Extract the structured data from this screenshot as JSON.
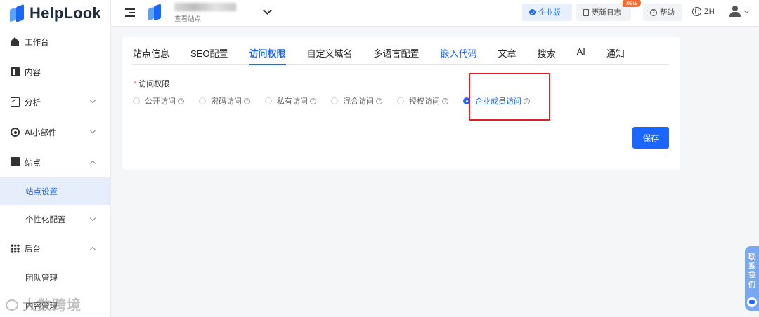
{
  "brand": {
    "name": "HelpLook"
  },
  "sidebar": {
    "items": [
      {
        "label": "工作台",
        "icon": "home-icon"
      },
      {
        "label": "内容",
        "icon": "book-icon"
      },
      {
        "label": "分析",
        "icon": "chart-icon",
        "expandable": true
      },
      {
        "label": "AI小部件",
        "icon": "ai-widget-icon",
        "expandable": true
      },
      {
        "label": "站点",
        "icon": "monitor-icon",
        "expanded": true
      }
    ],
    "site_sub": [
      {
        "label": "站点设置",
        "active": true
      },
      {
        "label": "个性化配置",
        "expandable": true
      }
    ],
    "backend": {
      "label": "后台",
      "icon": "grid-icon",
      "expanded": true
    },
    "backend_sub": [
      {
        "label": "团队管理"
      },
      {
        "label": "内容管理"
      }
    ]
  },
  "header": {
    "view_site": "查看站点",
    "enterprise": "企业版",
    "changelog": "更新日志",
    "new_badge": "new",
    "help": "帮助",
    "language": "ZH"
  },
  "tabs": [
    {
      "label": "站点信息"
    },
    {
      "label": "SEO配置"
    },
    {
      "label": "访问权限",
      "active": true
    },
    {
      "label": "自定义域名"
    },
    {
      "label": "多语言配置"
    },
    {
      "label": "嵌入代码",
      "link": true
    },
    {
      "label": "文章"
    },
    {
      "label": "搜索"
    },
    {
      "label": "AI"
    },
    {
      "label": "通知"
    }
  ],
  "access": {
    "label": "访问权限",
    "required_mark": "*",
    "options": [
      {
        "label": "公开访问"
      },
      {
        "label": "密码访问"
      },
      {
        "label": "私有访问"
      },
      {
        "label": "混合访问"
      },
      {
        "label": "授权访问"
      },
      {
        "label": "企业成员访问",
        "selected": true
      }
    ]
  },
  "save_label": "保存",
  "contact": {
    "label": "联系我们"
  },
  "watermark": "大数跨境",
  "colors": {
    "accent": "#1a66ff",
    "highlight": "#e02020",
    "badge": "#ff6a2e"
  }
}
